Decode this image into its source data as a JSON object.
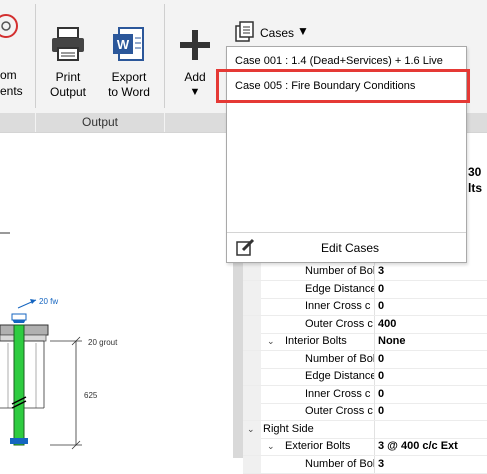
{
  "ribbon": {
    "partial_left_label_line1": "om",
    "partial_left_label_line2": "ents",
    "print_label_line1": "Print",
    "print_label_line2": "Output",
    "export_label_line1": "Export",
    "export_label_line2": "to Word",
    "output_group_label": "Output",
    "add_label": "Add",
    "add_arrow": "▼",
    "cases_label": "Cases",
    "cases_arrow": "▼"
  },
  "cases_menu": {
    "items": [
      "Case 001 : 1.4 (Dead+Services) + 1.6 Live",
      "Case 005 : Fire Boundary Conditions"
    ],
    "edit_label": "Edit Cases"
  },
  "background_text": {
    "peek_1": "30",
    "peek_2": "lts"
  },
  "drawing": {
    "fw_label": "20 fw",
    "grout_label": "20 grout",
    "dim_label": "625"
  },
  "property_grid": {
    "rows": [
      {
        "name": "Number of Bolts",
        "value": "3",
        "indent": 2
      },
      {
        "name": "Edge Distance",
        "value": "0",
        "indent": 2
      },
      {
        "name": "Inner Cross c",
        "value": "0",
        "indent": 2
      },
      {
        "name": "Outer Cross c",
        "value": "400",
        "indent": 2
      },
      {
        "name": "Interior Bolts",
        "value": "None",
        "indent": 1,
        "expander": "⌄"
      },
      {
        "name": "Number of Bolts",
        "value": "0",
        "indent": 2
      },
      {
        "name": "Edge Distance",
        "value": "0",
        "indent": 2
      },
      {
        "name": "Inner Cross c",
        "value": "0",
        "indent": 2
      },
      {
        "name": "Outer Cross c",
        "value": "0",
        "indent": 2
      },
      {
        "name": "Right Side",
        "value": "",
        "indent": 0,
        "expander": "⌄"
      },
      {
        "name": "Exterior Bolts",
        "value": "3 @ 400 c/c Ext",
        "indent": 1,
        "expander": "⌄"
      },
      {
        "name": "Number of Bolts",
        "value": "3",
        "indent": 2
      }
    ]
  },
  "colors": {
    "highlight": "#e53935",
    "bolt_green": "#2ecc40",
    "word_blue": "#2b579a",
    "plate_blue": "#1565c0"
  }
}
